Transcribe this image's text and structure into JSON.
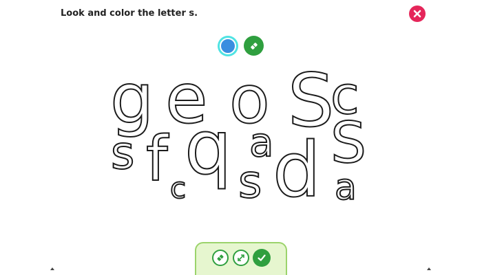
{
  "instruction": "Look and color the letter s.",
  "header": {
    "close_icon": "close-icon",
    "close_color": "#e5265a"
  },
  "palette": {
    "selected_color": "#3a8ee0",
    "selected_ring_color": "#4fe3e3",
    "eraser_icon": "eraser-icon",
    "eraser_color": "#2f9f3f"
  },
  "letters": [
    {
      "char": "g"
    },
    {
      "char": "e"
    },
    {
      "char": "o"
    },
    {
      "char": "S"
    },
    {
      "char": "c"
    },
    {
      "char": "s"
    },
    {
      "char": "f"
    },
    {
      "char": "c"
    },
    {
      "char": "q"
    },
    {
      "char": "a"
    },
    {
      "char": "s"
    },
    {
      "char": "d"
    },
    {
      "char": "S"
    },
    {
      "char": "a"
    }
  ],
  "toolbar": {
    "erase_icon": "eraser-icon",
    "resize_icon": "resize-icon",
    "done_icon": "checkmark-icon",
    "accent_color": "#2f9f3f",
    "background_color": "#e6f6cf"
  }
}
